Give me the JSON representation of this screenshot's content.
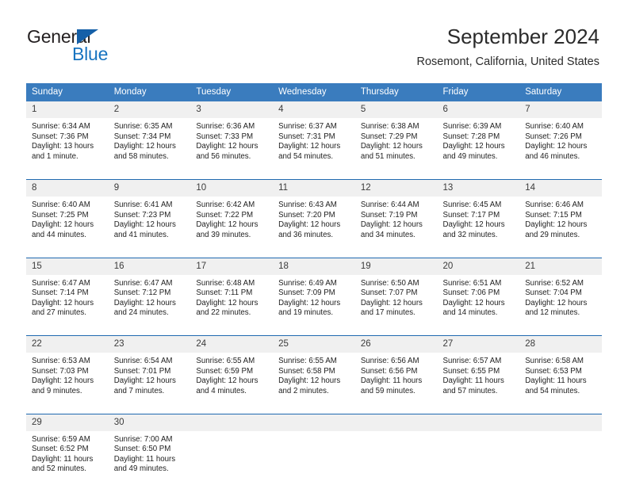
{
  "brand": {
    "name_top": "General",
    "name_bottom": "Blue",
    "accent_color": "#1874c0",
    "triangle_color": "#1560a8"
  },
  "header": {
    "title": "September 2024",
    "subtitle": "Rosemont, California, United States"
  },
  "theme": {
    "header_row_bg": "#3a7cbe",
    "week_divider": "#1f69b0",
    "daynum_bg": "#f0f0f0"
  },
  "weekday_headers": [
    "Sunday",
    "Monday",
    "Tuesday",
    "Wednesday",
    "Thursday",
    "Friday",
    "Saturday"
  ],
  "labels": {
    "sunrise_prefix": "Sunrise:",
    "sunset_prefix": "Sunset:",
    "daylight_prefix": "Daylight:"
  },
  "weeks": [
    [
      {
        "day": "1",
        "sunrise": "Sunrise: 6:34 AM",
        "sunset": "Sunset: 7:36 PM",
        "daylight_line1": "Daylight: 13 hours",
        "daylight_line2": "and 1 minute."
      },
      {
        "day": "2",
        "sunrise": "Sunrise: 6:35 AM",
        "sunset": "Sunset: 7:34 PM",
        "daylight_line1": "Daylight: 12 hours",
        "daylight_line2": "and 58 minutes."
      },
      {
        "day": "3",
        "sunrise": "Sunrise: 6:36 AM",
        "sunset": "Sunset: 7:33 PM",
        "daylight_line1": "Daylight: 12 hours",
        "daylight_line2": "and 56 minutes."
      },
      {
        "day": "4",
        "sunrise": "Sunrise: 6:37 AM",
        "sunset": "Sunset: 7:31 PM",
        "daylight_line1": "Daylight: 12 hours",
        "daylight_line2": "and 54 minutes."
      },
      {
        "day": "5",
        "sunrise": "Sunrise: 6:38 AM",
        "sunset": "Sunset: 7:29 PM",
        "daylight_line1": "Daylight: 12 hours",
        "daylight_line2": "and 51 minutes."
      },
      {
        "day": "6",
        "sunrise": "Sunrise: 6:39 AM",
        "sunset": "Sunset: 7:28 PM",
        "daylight_line1": "Daylight: 12 hours",
        "daylight_line2": "and 49 minutes."
      },
      {
        "day": "7",
        "sunrise": "Sunrise: 6:40 AM",
        "sunset": "Sunset: 7:26 PM",
        "daylight_line1": "Daylight: 12 hours",
        "daylight_line2": "and 46 minutes."
      }
    ],
    [
      {
        "day": "8",
        "sunrise": "Sunrise: 6:40 AM",
        "sunset": "Sunset: 7:25 PM",
        "daylight_line1": "Daylight: 12 hours",
        "daylight_line2": "and 44 minutes."
      },
      {
        "day": "9",
        "sunrise": "Sunrise: 6:41 AM",
        "sunset": "Sunset: 7:23 PM",
        "daylight_line1": "Daylight: 12 hours",
        "daylight_line2": "and 41 minutes."
      },
      {
        "day": "10",
        "sunrise": "Sunrise: 6:42 AM",
        "sunset": "Sunset: 7:22 PM",
        "daylight_line1": "Daylight: 12 hours",
        "daylight_line2": "and 39 minutes."
      },
      {
        "day": "11",
        "sunrise": "Sunrise: 6:43 AM",
        "sunset": "Sunset: 7:20 PM",
        "daylight_line1": "Daylight: 12 hours",
        "daylight_line2": "and 36 minutes."
      },
      {
        "day": "12",
        "sunrise": "Sunrise: 6:44 AM",
        "sunset": "Sunset: 7:19 PM",
        "daylight_line1": "Daylight: 12 hours",
        "daylight_line2": "and 34 minutes."
      },
      {
        "day": "13",
        "sunrise": "Sunrise: 6:45 AM",
        "sunset": "Sunset: 7:17 PM",
        "daylight_line1": "Daylight: 12 hours",
        "daylight_line2": "and 32 minutes."
      },
      {
        "day": "14",
        "sunrise": "Sunrise: 6:46 AM",
        "sunset": "Sunset: 7:15 PM",
        "daylight_line1": "Daylight: 12 hours",
        "daylight_line2": "and 29 minutes."
      }
    ],
    [
      {
        "day": "15",
        "sunrise": "Sunrise: 6:47 AM",
        "sunset": "Sunset: 7:14 PM",
        "daylight_line1": "Daylight: 12 hours",
        "daylight_line2": "and 27 minutes."
      },
      {
        "day": "16",
        "sunrise": "Sunrise: 6:47 AM",
        "sunset": "Sunset: 7:12 PM",
        "daylight_line1": "Daylight: 12 hours",
        "daylight_line2": "and 24 minutes."
      },
      {
        "day": "17",
        "sunrise": "Sunrise: 6:48 AM",
        "sunset": "Sunset: 7:11 PM",
        "daylight_line1": "Daylight: 12 hours",
        "daylight_line2": "and 22 minutes."
      },
      {
        "day": "18",
        "sunrise": "Sunrise: 6:49 AM",
        "sunset": "Sunset: 7:09 PM",
        "daylight_line1": "Daylight: 12 hours",
        "daylight_line2": "and 19 minutes."
      },
      {
        "day": "19",
        "sunrise": "Sunrise: 6:50 AM",
        "sunset": "Sunset: 7:07 PM",
        "daylight_line1": "Daylight: 12 hours",
        "daylight_line2": "and 17 minutes."
      },
      {
        "day": "20",
        "sunrise": "Sunrise: 6:51 AM",
        "sunset": "Sunset: 7:06 PM",
        "daylight_line1": "Daylight: 12 hours",
        "daylight_line2": "and 14 minutes."
      },
      {
        "day": "21",
        "sunrise": "Sunrise: 6:52 AM",
        "sunset": "Sunset: 7:04 PM",
        "daylight_line1": "Daylight: 12 hours",
        "daylight_line2": "and 12 minutes."
      }
    ],
    [
      {
        "day": "22",
        "sunrise": "Sunrise: 6:53 AM",
        "sunset": "Sunset: 7:03 PM",
        "daylight_line1": "Daylight: 12 hours",
        "daylight_line2": "and 9 minutes."
      },
      {
        "day": "23",
        "sunrise": "Sunrise: 6:54 AM",
        "sunset": "Sunset: 7:01 PM",
        "daylight_line1": "Daylight: 12 hours",
        "daylight_line2": "and 7 minutes."
      },
      {
        "day": "24",
        "sunrise": "Sunrise: 6:55 AM",
        "sunset": "Sunset: 6:59 PM",
        "daylight_line1": "Daylight: 12 hours",
        "daylight_line2": "and 4 minutes."
      },
      {
        "day": "25",
        "sunrise": "Sunrise: 6:55 AM",
        "sunset": "Sunset: 6:58 PM",
        "daylight_line1": "Daylight: 12 hours",
        "daylight_line2": "and 2 minutes."
      },
      {
        "day": "26",
        "sunrise": "Sunrise: 6:56 AM",
        "sunset": "Sunset: 6:56 PM",
        "daylight_line1": "Daylight: 11 hours",
        "daylight_line2": "and 59 minutes."
      },
      {
        "day": "27",
        "sunrise": "Sunrise: 6:57 AM",
        "sunset": "Sunset: 6:55 PM",
        "daylight_line1": "Daylight: 11 hours",
        "daylight_line2": "and 57 minutes."
      },
      {
        "day": "28",
        "sunrise": "Sunrise: 6:58 AM",
        "sunset": "Sunset: 6:53 PM",
        "daylight_line1": "Daylight: 11 hours",
        "daylight_line2": "and 54 minutes."
      }
    ],
    [
      {
        "day": "29",
        "sunrise": "Sunrise: 6:59 AM",
        "sunset": "Sunset: 6:52 PM",
        "daylight_line1": "Daylight: 11 hours",
        "daylight_line2": "and 52 minutes."
      },
      {
        "day": "30",
        "sunrise": "Sunrise: 7:00 AM",
        "sunset": "Sunset: 6:50 PM",
        "daylight_line1": "Daylight: 11 hours",
        "daylight_line2": "and 49 minutes."
      },
      {
        "day": "",
        "sunrise": "",
        "sunset": "",
        "daylight_line1": "",
        "daylight_line2": ""
      },
      {
        "day": "",
        "sunrise": "",
        "sunset": "",
        "daylight_line1": "",
        "daylight_line2": ""
      },
      {
        "day": "",
        "sunrise": "",
        "sunset": "",
        "daylight_line1": "",
        "daylight_line2": ""
      },
      {
        "day": "",
        "sunrise": "",
        "sunset": "",
        "daylight_line1": "",
        "daylight_line2": ""
      },
      {
        "day": "",
        "sunrise": "",
        "sunset": "",
        "daylight_line1": "",
        "daylight_line2": ""
      }
    ]
  ]
}
